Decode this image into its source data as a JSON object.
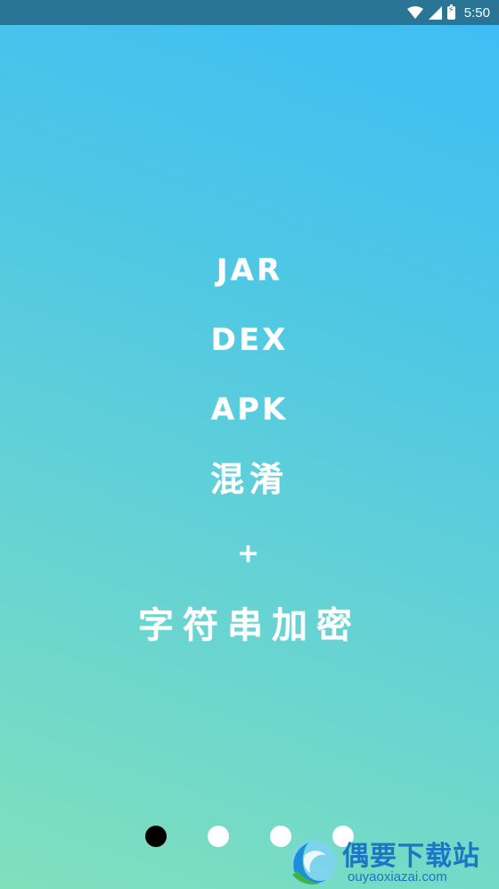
{
  "status_bar": {
    "time": "5:50",
    "icons": [
      "wifi-icon",
      "cell-signal-icon",
      "battery-charging-icon"
    ]
  },
  "slide": {
    "lines": [
      "JAR",
      "DEX",
      "APK",
      "混淆",
      "+",
      "字符串加密"
    ]
  },
  "pager": {
    "count": 4,
    "active_index": 0
  },
  "watermark": {
    "name": "偶要下载站",
    "url": "ouyaoxiazai.com"
  },
  "colors": {
    "status_bar": "#2a7596",
    "gradient_top": "#3fbcf6",
    "gradient_bottom": "#80e0bd",
    "text": "#ffffff",
    "dot_active": "#000000",
    "dot_inactive": "#ffffff",
    "watermark": "#1b76c4"
  }
}
